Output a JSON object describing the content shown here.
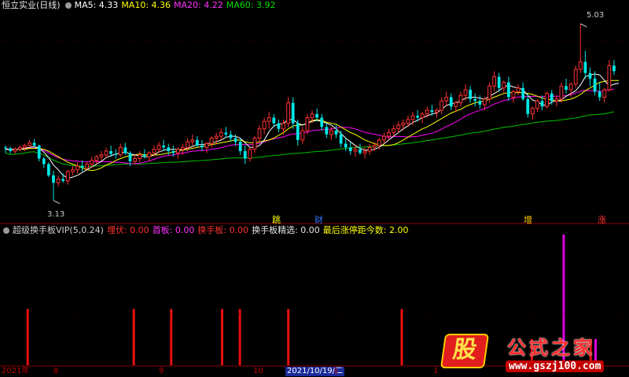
{
  "main_header": {
    "title": "恒立实业(日线)",
    "ma5": "MA5: 4.33",
    "ma10": "MA10: 4.36",
    "ma20": "MA20: 4.22",
    "ma60": "MA60: 3.92"
  },
  "indicator_header": {
    "name": "超级换手板VIP(5,0.24)",
    "f1": "埋伏: 0.00",
    "f2": "首板: 0.00",
    "f3": "换手板: 0.00",
    "f4": "换手板精选: 0.00",
    "f5": "最后涨停距今数: 2.00"
  },
  "annotations": {
    "high": "5.03",
    "low": "3.13"
  },
  "signals": {
    "s1": "跳",
    "s2": "财",
    "s3": "增",
    "s4": "涨"
  },
  "axis": {
    "labels": [
      "2021年",
      "8",
      "9",
      "10",
      "2021/10/19/二",
      "1",
      "1"
    ]
  },
  "logo": {
    "badge": "股",
    "title": "公式之家",
    "url": "www.gszj100.com"
  },
  "colors": {
    "up": "#ff3232",
    "down": "#00e6e6",
    "ma5": "#ffffff",
    "ma10": "#ffff00",
    "ma20": "#ff00ff",
    "ma60": "#00c000",
    "bar_red": "#e81010",
    "bar_magenta": "#e000e0"
  },
  "chart_data": {
    "type": "candlestick",
    "price_range": [
      3.0,
      5.15
    ],
    "high_price": 5.03,
    "low_price": 3.13,
    "candles": [
      [
        3.7,
        3.72,
        3.64,
        3.69
      ],
      [
        3.69,
        3.71,
        3.63,
        3.66
      ],
      [
        3.66,
        3.7,
        3.63,
        3.68
      ],
      [
        3.68,
        3.72,
        3.66,
        3.7
      ],
      [
        3.7,
        3.74,
        3.66,
        3.72
      ],
      [
        3.72,
        3.78,
        3.7,
        3.75
      ],
      [
        3.75,
        3.79,
        3.7,
        3.72
      ],
      [
        3.72,
        3.73,
        3.55,
        3.58
      ],
      [
        3.58,
        3.6,
        3.48,
        3.52
      ],
      [
        3.52,
        3.54,
        3.38,
        3.4
      ],
      [
        3.4,
        3.45,
        3.13,
        3.32
      ],
      [
        3.32,
        3.4,
        3.28,
        3.36
      ],
      [
        3.36,
        3.42,
        3.32,
        3.34
      ],
      [
        3.34,
        3.46,
        3.3,
        3.44
      ],
      [
        3.44,
        3.5,
        3.4,
        3.46
      ],
      [
        3.46,
        3.54,
        3.42,
        3.5
      ],
      [
        3.5,
        3.56,
        3.44,
        3.48
      ],
      [
        3.48,
        3.55,
        3.46,
        3.52
      ],
      [
        3.52,
        3.6,
        3.48,
        3.56
      ],
      [
        3.56,
        3.62,
        3.52,
        3.6
      ],
      [
        3.6,
        3.66,
        3.56,
        3.62
      ],
      [
        3.62,
        3.7,
        3.58,
        3.66
      ],
      [
        3.66,
        3.72,
        3.6,
        3.63
      ],
      [
        3.63,
        3.68,
        3.58,
        3.62
      ],
      [
        3.62,
        3.74,
        3.6,
        3.7
      ],
      [
        3.7,
        3.75,
        3.62,
        3.64
      ],
      [
        3.64,
        3.66,
        3.5,
        3.55
      ],
      [
        3.55,
        3.62,
        3.52,
        3.58
      ],
      [
        3.58,
        3.66,
        3.54,
        3.62
      ],
      [
        3.62,
        3.68,
        3.58,
        3.6
      ],
      [
        3.6,
        3.66,
        3.55,
        3.64
      ],
      [
        3.64,
        3.72,
        3.6,
        3.68
      ],
      [
        3.68,
        3.76,
        3.64,
        3.72
      ],
      [
        3.72,
        3.78,
        3.66,
        3.7
      ],
      [
        3.7,
        3.74,
        3.62,
        3.66
      ],
      [
        3.66,
        3.72,
        3.6,
        3.64
      ],
      [
        3.64,
        3.7,
        3.58,
        3.68
      ],
      [
        3.68,
        3.74,
        3.62,
        3.7
      ],
      [
        3.7,
        3.8,
        3.66,
        3.76
      ],
      [
        3.76,
        3.84,
        3.72,
        3.78
      ],
      [
        3.78,
        3.82,
        3.7,
        3.72
      ],
      [
        3.72,
        3.78,
        3.66,
        3.7
      ],
      [
        3.7,
        3.76,
        3.64,
        3.74
      ],
      [
        3.74,
        3.82,
        3.7,
        3.8
      ],
      [
        3.8,
        3.86,
        3.74,
        3.82
      ],
      [
        3.82,
        3.9,
        3.78,
        3.86
      ],
      [
        3.86,
        3.92,
        3.8,
        3.84
      ],
      [
        3.84,
        3.88,
        3.76,
        3.8
      ],
      [
        3.8,
        3.84,
        3.72,
        3.76
      ],
      [
        3.76,
        3.8,
        3.62,
        3.66
      ],
      [
        3.66,
        3.72,
        3.52,
        3.58
      ],
      [
        3.58,
        3.7,
        3.55,
        3.68
      ],
      [
        3.68,
        3.82,
        3.64,
        3.8
      ],
      [
        3.8,
        3.94,
        3.76,
        3.9
      ],
      [
        3.9,
        4.02,
        3.84,
        3.98
      ],
      [
        3.98,
        4.08,
        3.9,
        4.02
      ],
      [
        4.02,
        4.06,
        3.92,
        3.96
      ],
      [
        3.96,
        4.0,
        3.86,
        3.9
      ],
      [
        3.9,
        4.0,
        3.84,
        3.96
      ],
      [
        3.96,
        4.24,
        3.92,
        4.18
      ],
      [
        4.18,
        4.24,
        3.9,
        3.96
      ],
      [
        3.96,
        4.0,
        3.72,
        3.78
      ],
      [
        3.78,
        3.92,
        3.74,
        3.88
      ],
      [
        3.88,
        4.06,
        3.84,
        4.02
      ],
      [
        4.02,
        4.1,
        3.96,
        4.06
      ],
      [
        4.06,
        4.12,
        3.98,
        4.02
      ],
      [
        4.02,
        4.06,
        3.88,
        3.92
      ],
      [
        3.92,
        3.96,
        3.8,
        3.84
      ],
      [
        3.84,
        3.92,
        3.78,
        3.88
      ],
      [
        3.88,
        3.94,
        3.8,
        3.84
      ],
      [
        3.84,
        3.88,
        3.7,
        3.74
      ],
      [
        3.74,
        3.8,
        3.66,
        3.7
      ],
      [
        3.7,
        3.76,
        3.62,
        3.66
      ],
      [
        3.66,
        3.72,
        3.6,
        3.68
      ],
      [
        3.68,
        3.74,
        3.62,
        3.64
      ],
      [
        3.64,
        3.7,
        3.58,
        3.66
      ],
      [
        3.66,
        3.74,
        3.62,
        3.7
      ],
      [
        3.7,
        3.76,
        3.66,
        3.72
      ],
      [
        3.72,
        3.8,
        3.68,
        3.78
      ],
      [
        3.78,
        3.86,
        3.74,
        3.82
      ],
      [
        3.82,
        3.9,
        3.78,
        3.86
      ],
      [
        3.86,
        3.94,
        3.82,
        3.9
      ],
      [
        3.9,
        3.98,
        3.86,
        3.94
      ],
      [
        3.94,
        4.0,
        3.88,
        3.96
      ],
      [
        3.96,
        4.04,
        3.92,
        4.0
      ],
      [
        4.0,
        4.08,
        3.94,
        4.04
      ],
      [
        4.04,
        4.1,
        3.98,
        4.02
      ],
      [
        4.02,
        4.08,
        3.96,
        4.06
      ],
      [
        4.06,
        4.14,
        4.02,
        4.1
      ],
      [
        4.1,
        4.16,
        4.04,
        4.08
      ],
      [
        4.08,
        4.12,
        4.02,
        4.1
      ],
      [
        4.1,
        4.24,
        4.06,
        4.2
      ],
      [
        4.2,
        4.3,
        4.14,
        4.24
      ],
      [
        4.24,
        4.28,
        4.1,
        4.14
      ],
      [
        4.14,
        4.2,
        4.08,
        4.18
      ],
      [
        4.18,
        4.3,
        4.14,
        4.26
      ],
      [
        4.26,
        4.38,
        4.2,
        4.32
      ],
      [
        4.32,
        4.36,
        4.18,
        4.22
      ],
      [
        4.22,
        4.28,
        4.14,
        4.2
      ],
      [
        4.2,
        4.26,
        4.12,
        4.16
      ],
      [
        4.16,
        4.24,
        4.1,
        4.22
      ],
      [
        4.22,
        4.4,
        4.18,
        4.36
      ],
      [
        4.36,
        4.52,
        4.3,
        4.46
      ],
      [
        4.46,
        4.5,
        4.3,
        4.34
      ],
      [
        4.34,
        4.42,
        4.28,
        4.4
      ],
      [
        4.4,
        4.46,
        4.2,
        4.24
      ],
      [
        4.24,
        4.32,
        4.18,
        4.3
      ],
      [
        4.3,
        4.38,
        4.26,
        4.34
      ],
      [
        4.34,
        4.4,
        4.2,
        4.22
      ],
      [
        4.22,
        4.28,
        4.02,
        4.06
      ],
      [
        4.06,
        4.14,
        4.0,
        4.12
      ],
      [
        4.12,
        4.22,
        4.08,
        4.2
      ],
      [
        4.2,
        4.26,
        4.1,
        4.14
      ],
      [
        4.14,
        4.3,
        4.12,
        4.28
      ],
      [
        4.28,
        4.32,
        4.16,
        4.2
      ],
      [
        4.2,
        4.26,
        4.14,
        4.22
      ],
      [
        4.22,
        4.4,
        4.18,
        4.36
      ],
      [
        4.36,
        4.44,
        4.28,
        4.32
      ],
      [
        4.32,
        4.4,
        4.24,
        4.38
      ],
      [
        4.38,
        4.58,
        4.34,
        4.54
      ],
      [
        4.54,
        5.03,
        4.5,
        4.62
      ],
      [
        4.62,
        4.74,
        4.44,
        4.5
      ],
      [
        4.5,
        4.56,
        4.36,
        4.44
      ],
      [
        4.44,
        4.52,
        4.26,
        4.3
      ],
      [
        4.3,
        4.4,
        4.2,
        4.24
      ],
      [
        4.24,
        4.34,
        4.18,
        4.32
      ],
      [
        4.32,
        4.64,
        4.3,
        4.58
      ],
      [
        4.58,
        4.64,
        4.48,
        4.52
      ]
    ],
    "ma5": [
      3.68,
      3.68,
      3.68,
      3.68,
      3.69,
      3.7,
      3.71,
      3.69,
      3.65,
      3.59,
      3.51,
      3.46,
      3.4,
      3.37,
      3.38,
      3.4,
      3.43,
      3.46,
      3.49,
      3.52,
      3.55,
      3.59,
      3.61,
      3.63,
      3.64,
      3.65,
      3.63,
      3.62,
      3.61,
      3.6,
      3.6,
      3.62,
      3.65,
      3.67,
      3.68,
      3.68,
      3.68,
      3.68,
      3.69,
      3.71,
      3.73,
      3.73,
      3.74,
      3.75,
      3.76,
      3.78,
      3.81,
      3.82,
      3.82,
      3.8,
      3.75,
      3.7,
      3.7,
      3.72,
      3.78,
      3.87,
      3.93,
      3.95,
      3.96,
      4.0,
      4.0,
      3.96,
      3.94,
      3.96,
      3.98,
      3.99,
      3.98,
      3.96,
      3.94,
      3.9,
      3.85,
      3.8,
      3.76,
      3.72,
      3.69,
      3.67,
      3.67,
      3.68,
      3.7,
      3.74,
      3.78,
      3.82,
      3.86,
      3.9,
      3.93,
      3.97,
      3.99,
      4.02,
      4.04,
      4.06,
      4.07,
      4.11,
      4.15,
      4.17,
      4.18,
      4.2,
      4.23,
      4.24,
      4.24,
      4.23,
      4.22,
      4.25,
      4.28,
      4.31,
      4.35,
      4.37,
      4.35,
      4.34,
      4.32,
      4.26,
      4.21,
      4.19,
      4.16,
      4.15,
      4.19,
      4.2,
      4.21,
      4.25,
      4.28,
      4.31,
      4.37,
      4.46,
      4.48,
      4.49,
      4.48,
      4.42,
      4.36,
      4.38,
      4.39
    ],
    "ma10": [
      3.68,
      3.68,
      3.68,
      3.68,
      3.68,
      3.69,
      3.69,
      3.69,
      3.68,
      3.66,
      3.63,
      3.6,
      3.57,
      3.54,
      3.52,
      3.5,
      3.48,
      3.46,
      3.45,
      3.46,
      3.48,
      3.51,
      3.53,
      3.56,
      3.58,
      3.6,
      3.61,
      3.62,
      3.63,
      3.62,
      3.62,
      3.62,
      3.62,
      3.63,
      3.64,
      3.65,
      3.66,
      3.67,
      3.68,
      3.69,
      3.7,
      3.71,
      3.72,
      3.73,
      3.74,
      3.75,
      3.76,
      3.77,
      3.78,
      3.78,
      3.76,
      3.75,
      3.75,
      3.76,
      3.77,
      3.78,
      3.8,
      3.83,
      3.86,
      3.9,
      3.93,
      3.94,
      3.94,
      3.96,
      3.99,
      4.0,
      3.99,
      3.97,
      3.96,
      3.95,
      3.92,
      3.89,
      3.86,
      3.84,
      3.81,
      3.78,
      3.76,
      3.74,
      3.73,
      3.72,
      3.72,
      3.73,
      3.75,
      3.78,
      3.81,
      3.84,
      3.87,
      3.9,
      3.92,
      3.95,
      3.98,
      4.01,
      4.04,
      4.07,
      4.09,
      4.11,
      4.14,
      4.16,
      4.18,
      4.19,
      4.2,
      4.22,
      4.24,
      4.26,
      4.28,
      4.29,
      4.29,
      4.29,
      4.29,
      4.28,
      4.27,
      4.25,
      4.23,
      4.22,
      4.21,
      4.2,
      4.2,
      4.21,
      4.22,
      4.24,
      4.27,
      4.31,
      4.34,
      4.37,
      4.4,
      4.41,
      4.42,
      4.42,
      4.42
    ]
  },
  "volume_bars": {
    "series_red": [
      {
        "pos": 0.04,
        "h": 0.43
      },
      {
        "pos": 0.213,
        "h": 0.43
      },
      {
        "pos": 0.274,
        "h": 0.43
      },
      {
        "pos": 0.357,
        "h": 0.43
      },
      {
        "pos": 0.386,
        "h": 0.43
      },
      {
        "pos": 0.465,
        "h": 0.43
      },
      {
        "pos": 0.65,
        "h": 0.43
      },
      {
        "pos": 0.744,
        "h": 0.2
      },
      {
        "pos": 0.862,
        "h": 0.2
      },
      {
        "pos": 0.958,
        "h": 0.2
      }
    ],
    "series_magenta": [
      {
        "pos": 0.914,
        "h": 1.0
      },
      {
        "pos": 0.966,
        "h": 0.2
      }
    ]
  }
}
